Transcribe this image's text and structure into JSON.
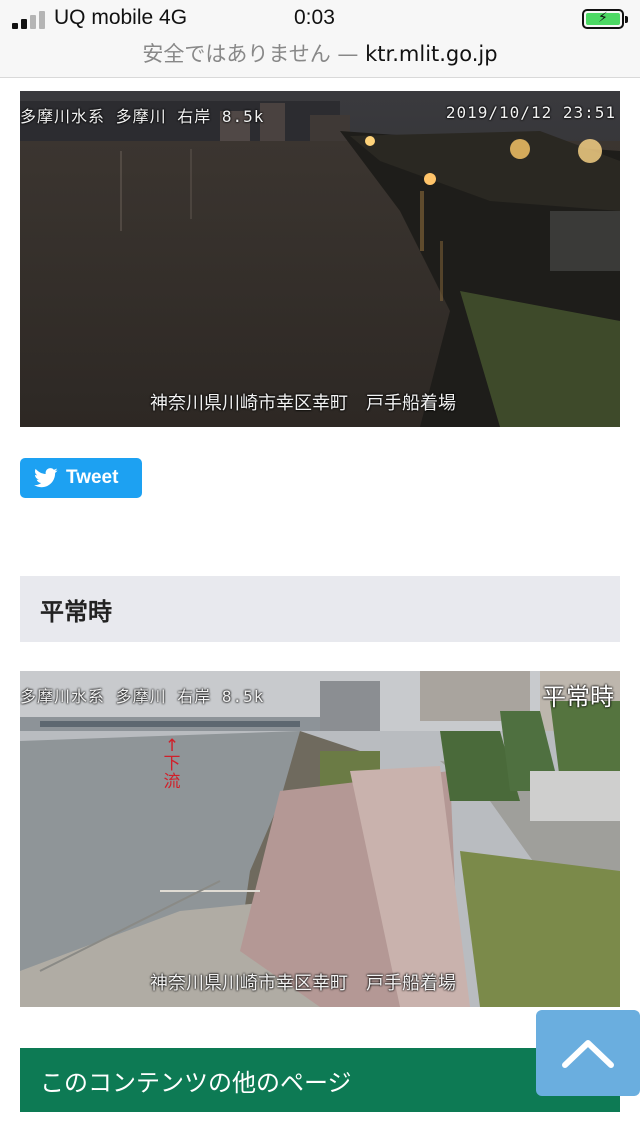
{
  "status_bar": {
    "carrier": "UQ mobile 4G",
    "time": "0:03",
    "battery_state": "charging",
    "signal_bars": 2,
    "signal_bars_total": 4
  },
  "url_bar": {
    "security_warning": "安全ではありません —",
    "domain": "ktr.mlit.go.jp"
  },
  "camera_live": {
    "river_label": "多摩川水系 多摩川 右岸 8.5k",
    "timestamp": "2019/10/12 23:51",
    "location": "神奈川県川崎市幸区幸町　戸手船着場"
  },
  "tweet": {
    "label": "Tweet",
    "icon": "twitter-bird-icon",
    "color": "#1da1f2"
  },
  "section": {
    "title": "平常時"
  },
  "camera_normal": {
    "river_label": "多摩川水系 多摩川 右岸 8.5k",
    "normal_label": "平常時",
    "flow_label_1": "下",
    "flow_label_2": "流",
    "location": "神奈川県川崎市幸区幸町　戸手船着場"
  },
  "other_pages": {
    "title": "このコンテンツの他のページ",
    "color": "#0d7a54"
  },
  "back_to_top": {
    "icon": "chevron-up-icon",
    "color": "#6aaedf"
  }
}
